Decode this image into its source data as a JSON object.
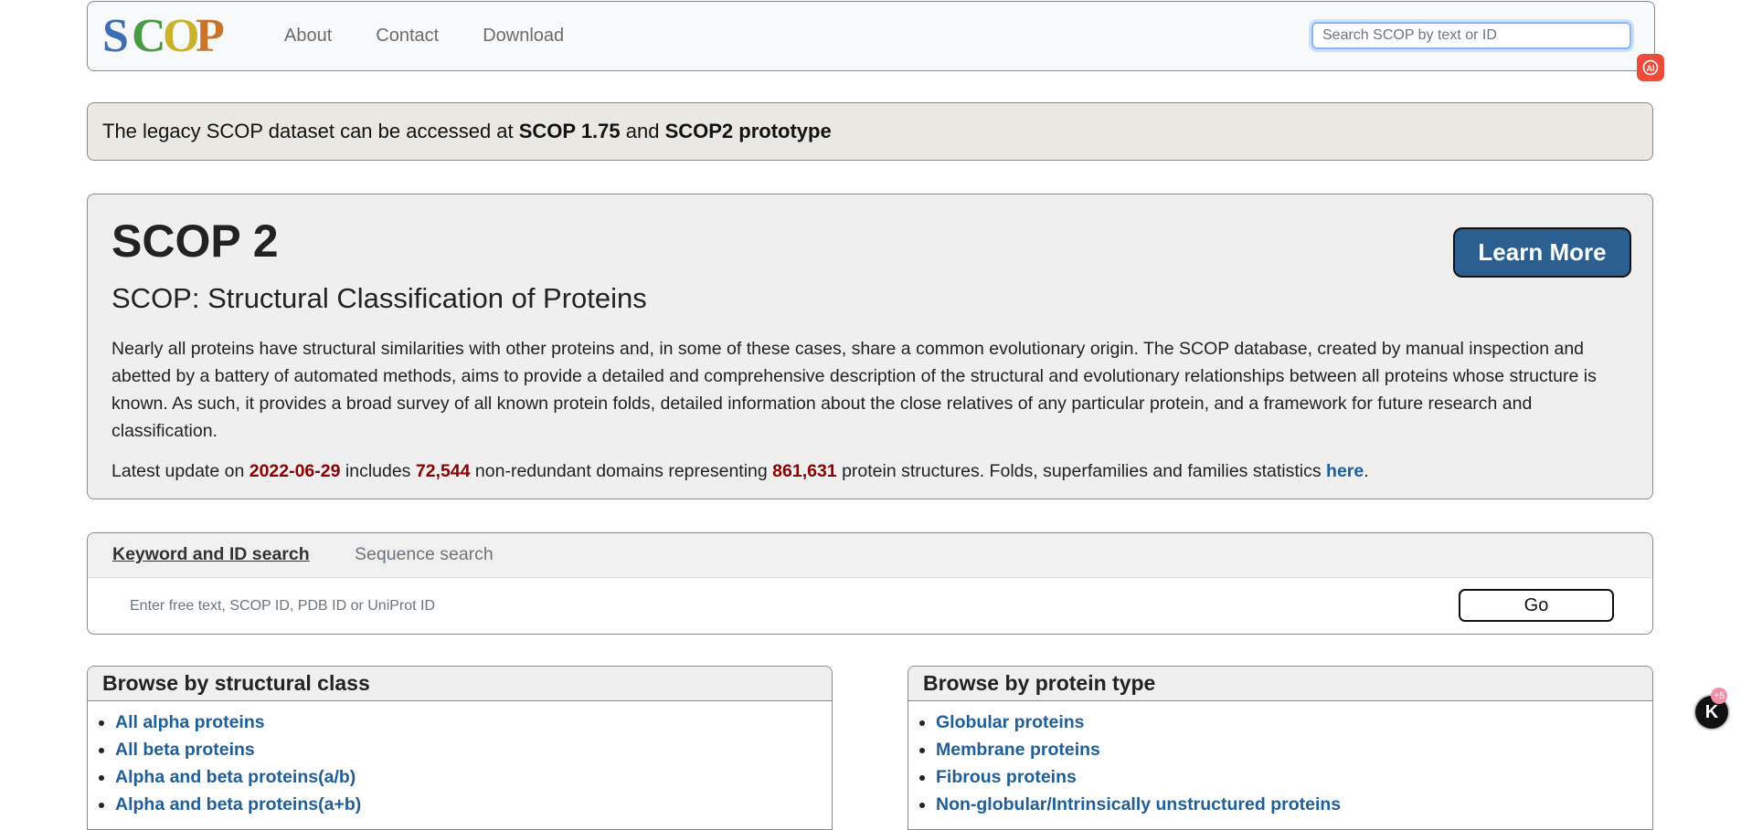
{
  "nav": {
    "logo_text": "SCOP",
    "links": [
      "About",
      "Contact",
      "Download"
    ],
    "search_placeholder": "Search SCOP by text or ID"
  },
  "legacy": {
    "text_before": "The legacy SCOP dataset can be accessed at ",
    "link1": "SCOP 1.75",
    "text_and": " and ",
    "link2": "SCOP2 prototype"
  },
  "hero": {
    "title": "SCOP 2",
    "subtitle": "SCOP: Structural Classification of Proteins",
    "learn_more": "Learn More",
    "description": "Nearly all proteins have structural similarities with other proteins and, in some of these cases, share a common evolutionary origin. The SCOP database, created by manual inspection and abetted by a battery of automated methods, aims to provide a detailed and comprehensive description of the structural and evolutionary relationships between all proteins whose structure is known. As such, it provides a broad survey of all known protein folds, detailed information about the close relatives of any particular protein, and a framework for future research and classification.",
    "update": {
      "prefix": "Latest update on ",
      "date": "2022-06-29",
      "mid1": " includes ",
      "domains": "72,544",
      "mid2": " non-redundant domains representing ",
      "structures": "861,631",
      "mid3": " protein structures. Folds, superfamilies and families statistics ",
      "link": "here",
      "end": "."
    }
  },
  "search": {
    "tab_active": "Keyword and ID search",
    "tab_inactive": "Sequence search",
    "placeholder": "Enter free text, SCOP ID, PDB ID or UniProt ID",
    "go": "Go"
  },
  "browse_class": {
    "title": "Browse by structural class",
    "items": [
      "All alpha proteins",
      "All beta proteins",
      "Alpha and beta proteins(a/b)",
      "Alpha and beta proteins(a+b)"
    ]
  },
  "browse_type": {
    "title": "Browse by protein type",
    "items": [
      "Globular proteins",
      "Membrane proteins",
      "Fibrous proteins",
      "Non-globular/Intrinsically unstructured proteins"
    ]
  },
  "badges": {
    "ai_icon": "ai-assistant-icon",
    "k_label": "K",
    "k_count": "+5"
  },
  "colors": {
    "accent_button": "#2a5f8f",
    "link": "#1f5f99",
    "stat_number": "#8b0000"
  }
}
